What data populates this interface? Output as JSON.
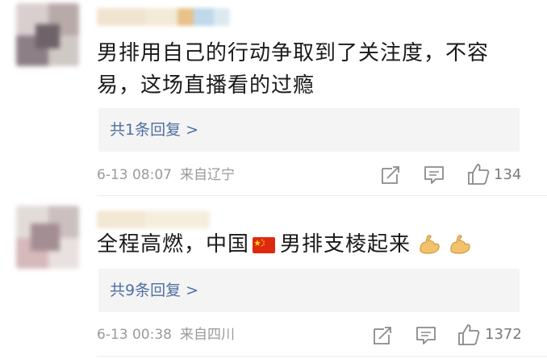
{
  "comments": [
    {
      "text_line1": "男排用自己的行动争取到了关注度，不容",
      "text_line2": "易，这场直播看的过瘾",
      "replies_label": "共1条回复 >",
      "time": "6-13 08:07",
      "location": "来自辽宁",
      "like_count": "134"
    },
    {
      "text_before_flag": "全程高燃，中国",
      "text_after_flag": "男排支棱起来",
      "replies_label": "共9条回复 >",
      "time": "6-13 00:38",
      "location": "来自四川",
      "like_count": "1372"
    }
  ],
  "icons": {
    "share": "share-icon",
    "comment": "comment-icon",
    "like": "thumbs-up-icon",
    "flag": "china-flag-emoji",
    "muscle": "flexed-biceps-emoji"
  },
  "colors": {
    "link": "#4e6fa3",
    "meta": "#9a9a9a",
    "reply_bg": "#f4f4f4"
  }
}
